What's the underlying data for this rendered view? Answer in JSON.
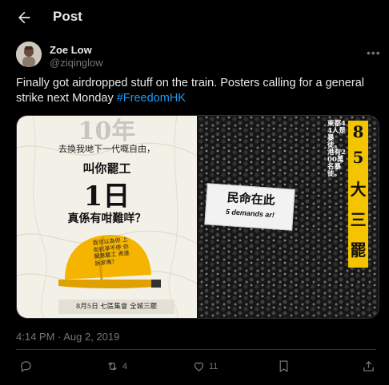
{
  "header": {
    "title": "Post",
    "back_icon": "arrow-left-icon"
  },
  "author": {
    "display_name": "Zoe Low",
    "handle": "@ziqinglow"
  },
  "tweet": {
    "text_before": "Finally got airdropped stuff on the train. Posters calling for a general strike next Monday ",
    "hashtag": "#FreedomHK",
    "timestamp": "4:14 PM · Aug 2, 2019"
  },
  "poster_left": {
    "year": "10年",
    "line1": "去換我哋下一代嘅自由，",
    "line2": "叫你罷工",
    "big": "1日",
    "line3": "真係有咁難咩？",
    "helmet_text": "我可以為你 上街抗爭不停 你願意罷工 表達訴求嗎？",
    "footer": "8月5日 七區集會 全城三罷"
  },
  "poster_right": {
    "vertical_text": "東都44人是暴徒。港有200萬名暴徒。",
    "yellow_chars": [
      "8",
      "5",
      "大",
      "三",
      "罷"
    ],
    "banner_main": "民命在此",
    "banner_sub": "5 demands ar!"
  },
  "actions": {
    "reply": {
      "icon": "reply-icon",
      "count": ""
    },
    "repost": {
      "icon": "repost-icon",
      "count": "4"
    },
    "like": {
      "icon": "heart-icon",
      "count": "11"
    },
    "bookmark": {
      "icon": "bookmark-icon"
    },
    "share": {
      "icon": "share-icon"
    }
  },
  "colors": {
    "accent": "#1d9bf0",
    "muted": "#71767b",
    "text": "#e7e9ea",
    "background": "#000000"
  }
}
